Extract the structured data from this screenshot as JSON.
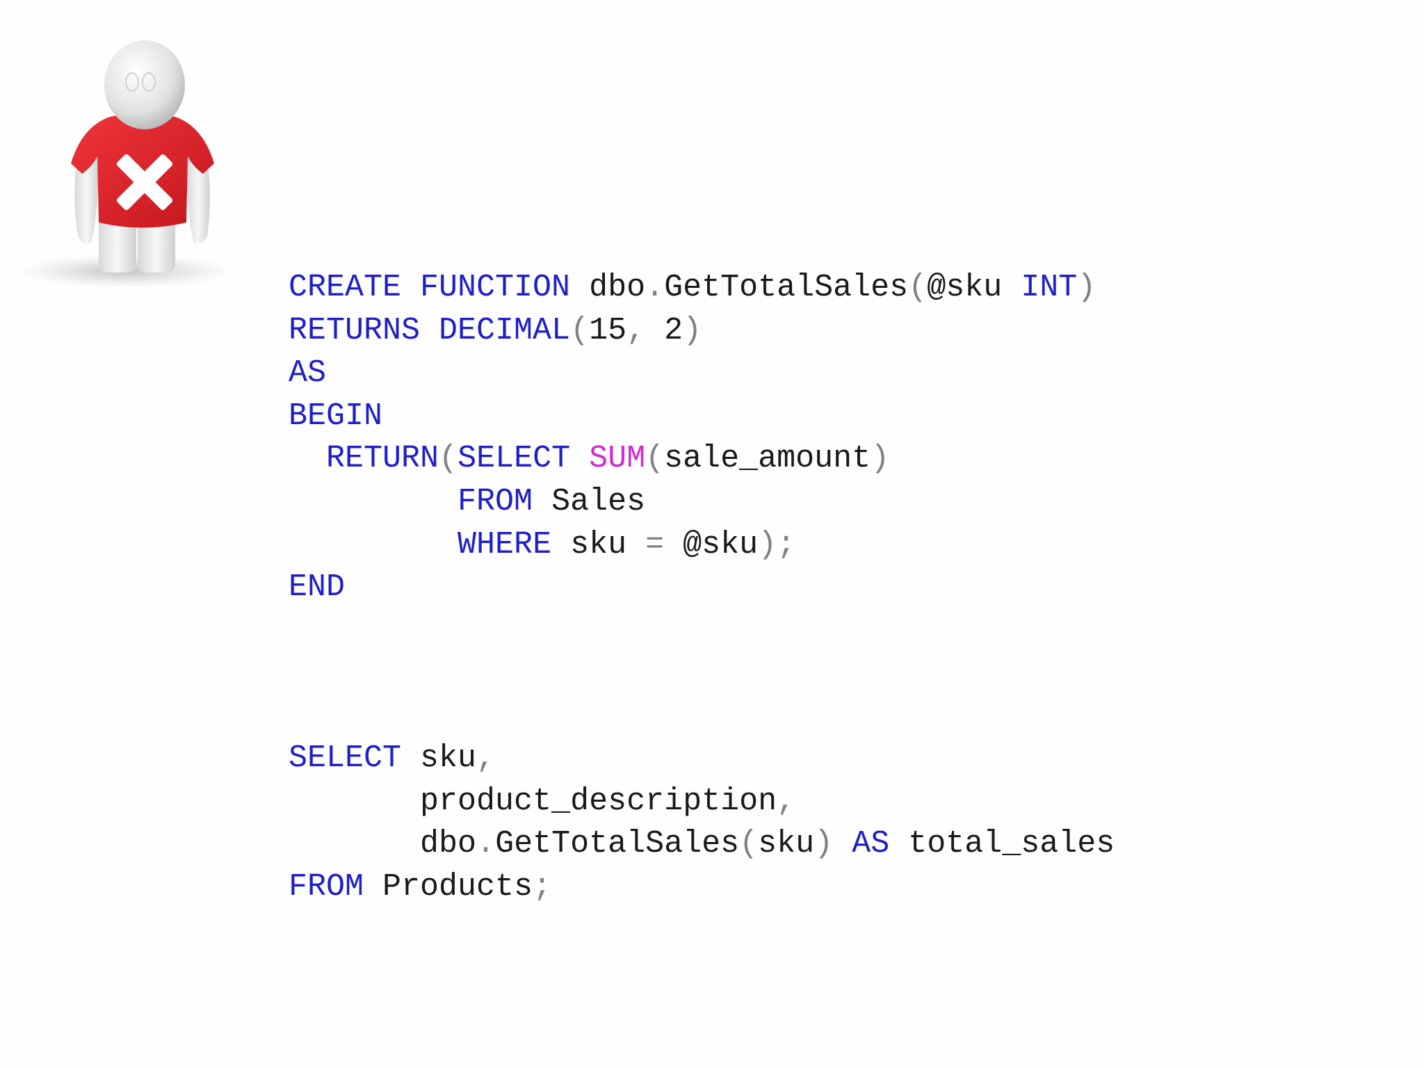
{
  "colors": {
    "keyword": "#1f1fc8",
    "function": "#d42ad4",
    "punctuation": "#808080",
    "identifier": "#1a1a1a",
    "figure_shirt": "#e21f26"
  },
  "figure": {
    "icon": "red-x-person-icon"
  },
  "code_block_1": [
    [
      {
        "t": "k",
        "v": "CREATE FUNCTION"
      },
      {
        "t": "i",
        "v": " dbo"
      },
      {
        "t": "p",
        "v": "."
      },
      {
        "t": "i",
        "v": "GetTotalSales"
      },
      {
        "t": "p",
        "v": "("
      },
      {
        "t": "i",
        "v": "@sku "
      },
      {
        "t": "k",
        "v": "INT"
      },
      {
        "t": "p",
        "v": ")"
      }
    ],
    [
      {
        "t": "k",
        "v": "RETURNS DECIMAL"
      },
      {
        "t": "p",
        "v": "("
      },
      {
        "t": "i",
        "v": "15"
      },
      {
        "t": "p",
        "v": ","
      },
      {
        "t": "i",
        "v": " 2"
      },
      {
        "t": "p",
        "v": ")"
      }
    ],
    [
      {
        "t": "k",
        "v": "AS"
      }
    ],
    [
      {
        "t": "k",
        "v": "BEGIN"
      }
    ],
    [
      {
        "t": "i",
        "v": "  "
      },
      {
        "t": "k",
        "v": "RETURN"
      },
      {
        "t": "p",
        "v": "("
      },
      {
        "t": "k",
        "v": "SELECT "
      },
      {
        "t": "f",
        "v": "SUM"
      },
      {
        "t": "p",
        "v": "("
      },
      {
        "t": "i",
        "v": "sale_amount"
      },
      {
        "t": "p",
        "v": ")"
      }
    ],
    [
      {
        "t": "i",
        "v": "         "
      },
      {
        "t": "k",
        "v": "FROM"
      },
      {
        "t": "i",
        "v": " Sales"
      }
    ],
    [
      {
        "t": "i",
        "v": "         "
      },
      {
        "t": "k",
        "v": "WHERE"
      },
      {
        "t": "i",
        "v": " sku "
      },
      {
        "t": "p",
        "v": "="
      },
      {
        "t": "i",
        "v": " @sku"
      },
      {
        "t": "p",
        "v": ");"
      }
    ],
    [
      {
        "t": "k",
        "v": "END"
      }
    ]
  ],
  "code_block_2": [
    [
      {
        "t": "k",
        "v": "SELECT"
      },
      {
        "t": "i",
        "v": " sku"
      },
      {
        "t": "p",
        "v": ","
      }
    ],
    [
      {
        "t": "i",
        "v": "       product_description"
      },
      {
        "t": "p",
        "v": ","
      }
    ],
    [
      {
        "t": "i",
        "v": "       dbo"
      },
      {
        "t": "p",
        "v": "."
      },
      {
        "t": "i",
        "v": "GetTotalSales"
      },
      {
        "t": "p",
        "v": "("
      },
      {
        "t": "i",
        "v": "sku"
      },
      {
        "t": "p",
        "v": ")"
      },
      {
        "t": "i",
        "v": " "
      },
      {
        "t": "k",
        "v": "AS"
      },
      {
        "t": "i",
        "v": " total_sales"
      }
    ],
    [
      {
        "t": "k",
        "v": "FROM"
      },
      {
        "t": "i",
        "v": " Products"
      },
      {
        "t": "p",
        "v": ";"
      }
    ]
  ]
}
